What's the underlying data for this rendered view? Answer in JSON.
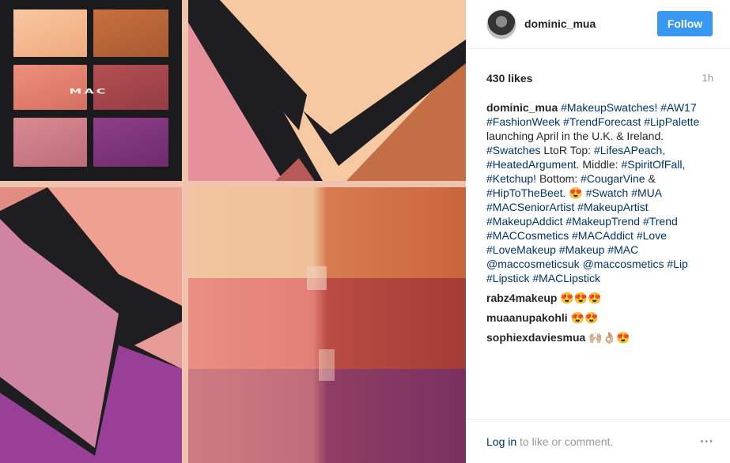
{
  "post": {
    "username": "dominic_mua",
    "follow_label": "Follow",
    "likes": "430 likes",
    "time": "1h",
    "caption_user": "dominic_mua",
    "caption_parts": [
      {
        "t": "tag",
        "v": "#MakeupSwatches!"
      },
      {
        "t": "txt",
        "v": " "
      },
      {
        "t": "tag",
        "v": "#AW17"
      },
      {
        "t": "txt",
        "v": " "
      },
      {
        "t": "tag",
        "v": "#FashionWeek"
      },
      {
        "t": "txt",
        "v": " "
      },
      {
        "t": "tag",
        "v": "#TrendForecast"
      },
      {
        "t": "txt",
        "v": " "
      },
      {
        "t": "tag",
        "v": "#LipPalette"
      },
      {
        "t": "txt",
        "v": " launching April in the U.K. & Ireland. "
      },
      {
        "t": "tag",
        "v": "#Swatches"
      },
      {
        "t": "txt",
        "v": " LtoR Top: "
      },
      {
        "t": "tag",
        "v": "#LifesAPeach,"
      },
      {
        "t": "txt",
        "v": " "
      },
      {
        "t": "tag",
        "v": "#HeatedArgument."
      },
      {
        "t": "txt",
        "v": " Middle: "
      },
      {
        "t": "tag",
        "v": "#SpiritOfFall,"
      },
      {
        "t": "txt",
        "v": " "
      },
      {
        "t": "tag",
        "v": "#Ketchup!"
      },
      {
        "t": "txt",
        "v": " Bottom: "
      },
      {
        "t": "tag",
        "v": "#CougarVine"
      },
      {
        "t": "txt",
        "v": " & "
      },
      {
        "t": "tag",
        "v": "#HipToTheBeet."
      },
      {
        "t": "txt",
        "v": " 😍 "
      },
      {
        "t": "tag",
        "v": "#Swatch"
      },
      {
        "t": "txt",
        "v": " "
      },
      {
        "t": "tag",
        "v": "#MUA"
      },
      {
        "t": "txt",
        "v": " "
      },
      {
        "t": "tag",
        "v": "#MACSeniorArtist"
      },
      {
        "t": "txt",
        "v": " "
      },
      {
        "t": "tag",
        "v": "#MakeupArtist"
      },
      {
        "t": "txt",
        "v": " "
      },
      {
        "t": "tag",
        "v": "#MakeupAddict"
      },
      {
        "t": "txt",
        "v": " "
      },
      {
        "t": "tag",
        "v": "#MakeupTrend"
      },
      {
        "t": "txt",
        "v": " "
      },
      {
        "t": "tag",
        "v": "#Trend"
      },
      {
        "t": "txt",
        "v": " "
      },
      {
        "t": "tag",
        "v": "#MACCosmetics"
      },
      {
        "t": "txt",
        "v": " "
      },
      {
        "t": "tag",
        "v": "#MACAddict"
      },
      {
        "t": "txt",
        "v": " "
      },
      {
        "t": "tag",
        "v": "#Love"
      },
      {
        "t": "txt",
        "v": " "
      },
      {
        "t": "tag",
        "v": "#LoveMakeup"
      },
      {
        "t": "txt",
        "v": " "
      },
      {
        "t": "tag",
        "v": "#Makeup"
      },
      {
        "t": "txt",
        "v": " "
      },
      {
        "t": "tag",
        "v": "#MAC"
      },
      {
        "t": "txt",
        "v": " "
      },
      {
        "t": "tag",
        "v": "@maccosmeticsuk"
      },
      {
        "t": "txt",
        "v": " "
      },
      {
        "t": "tag",
        "v": "@maccosmetics"
      },
      {
        "t": "txt",
        "v": " "
      },
      {
        "t": "tag",
        "v": "#Lip"
      },
      {
        "t": "txt",
        "v": " "
      },
      {
        "t": "tag",
        "v": "#Lipstick"
      },
      {
        "t": "txt",
        "v": " "
      },
      {
        "t": "tag",
        "v": "#MACLipstick"
      }
    ],
    "comments": [
      {
        "user": "rabz4makeup",
        "text": "😍😍😍"
      },
      {
        "user": "muaanupakohli",
        "text": "😍😍"
      },
      {
        "user": "sophiexdaviesmua",
        "text": "🙌🏼👌🏼😍"
      }
    ],
    "login_link": "Log in",
    "login_text": " to like or comment.",
    "more_icon": "•••"
  },
  "image": {
    "logo_text": "MAC",
    "accent": "#3897f0",
    "link_color": "#003569"
  }
}
